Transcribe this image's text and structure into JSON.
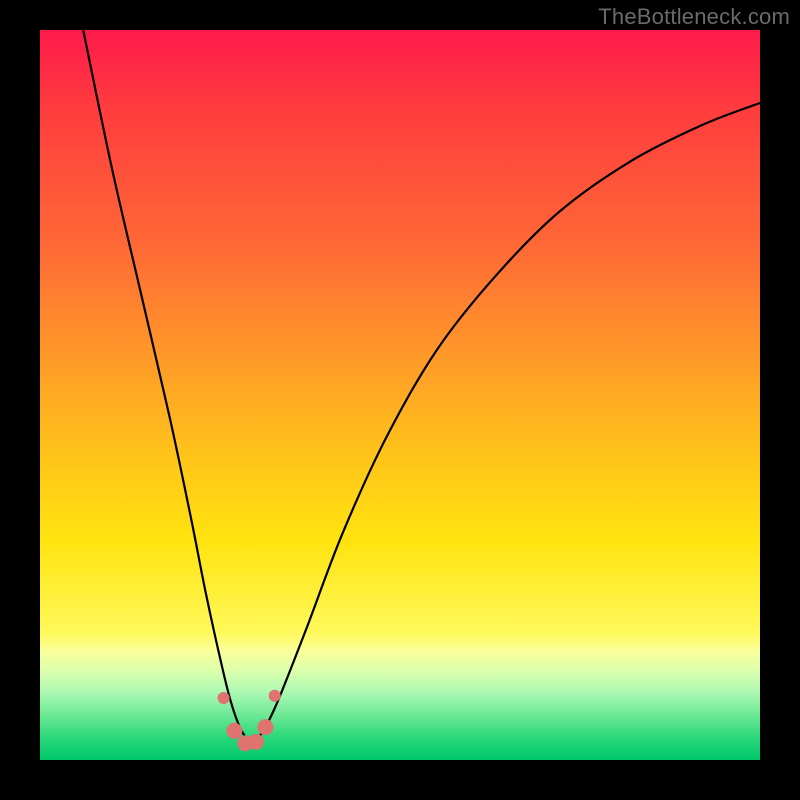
{
  "watermark": "TheBottleneck.com",
  "chart_data": {
    "type": "line",
    "title": "",
    "xlabel": "",
    "ylabel": "",
    "xlim": [
      0,
      100
    ],
    "ylim": [
      0,
      100
    ],
    "gradient_stops": [
      {
        "pct": 0,
        "color": "#ff1a4b"
      },
      {
        "pct": 10,
        "color": "#ff3a3f"
      },
      {
        "pct": 30,
        "color": "#ff6a35"
      },
      {
        "pct": 45,
        "color": "#ff9a28"
      },
      {
        "pct": 58,
        "color": "#ffc31a"
      },
      {
        "pct": 70,
        "color": "#ffe30f"
      },
      {
        "pct": 82.5,
        "color": "#fff95a"
      },
      {
        "pct": 85,
        "color": "#fbff99"
      },
      {
        "pct": 88,
        "color": "#d9ffae"
      },
      {
        "pct": 91,
        "color": "#a6f7b1"
      },
      {
        "pct": 94,
        "color": "#6ae894"
      },
      {
        "pct": 97,
        "color": "#28d77a"
      },
      {
        "pct": 100,
        "color": "#00c96b"
      }
    ],
    "series": [
      {
        "name": "bottleneck-curve",
        "stroke": "#000000",
        "stroke_width": 2.2,
        "x": [
          6,
          10,
          14,
          18,
          21,
          23,
          25,
          26.5,
          28,
          29.5,
          31,
          33,
          37,
          42,
          48,
          55,
          63,
          72,
          82,
          92,
          100
        ],
        "y": [
          100,
          81,
          64,
          47,
          33,
          23,
          14,
          8,
          4,
          2.5,
          4,
          8,
          18,
          31,
          44,
          56,
          66,
          75,
          82,
          87,
          90
        ]
      }
    ],
    "markers": {
      "name": "bottom-dot-cluster",
      "color": "#de736f",
      "radius_primary": 8,
      "radius_secondary": 6,
      "points": [
        {
          "x": 25.5,
          "y": 8.5,
          "r": 6
        },
        {
          "x": 27.0,
          "y": 4.0,
          "r": 8
        },
        {
          "x": 28.5,
          "y": 2.3,
          "r": 8
        },
        {
          "x": 30.0,
          "y": 2.5,
          "r": 8
        },
        {
          "x": 31.3,
          "y": 4.5,
          "r": 8
        },
        {
          "x": 32.6,
          "y": 8.8,
          "r": 6
        }
      ]
    }
  }
}
